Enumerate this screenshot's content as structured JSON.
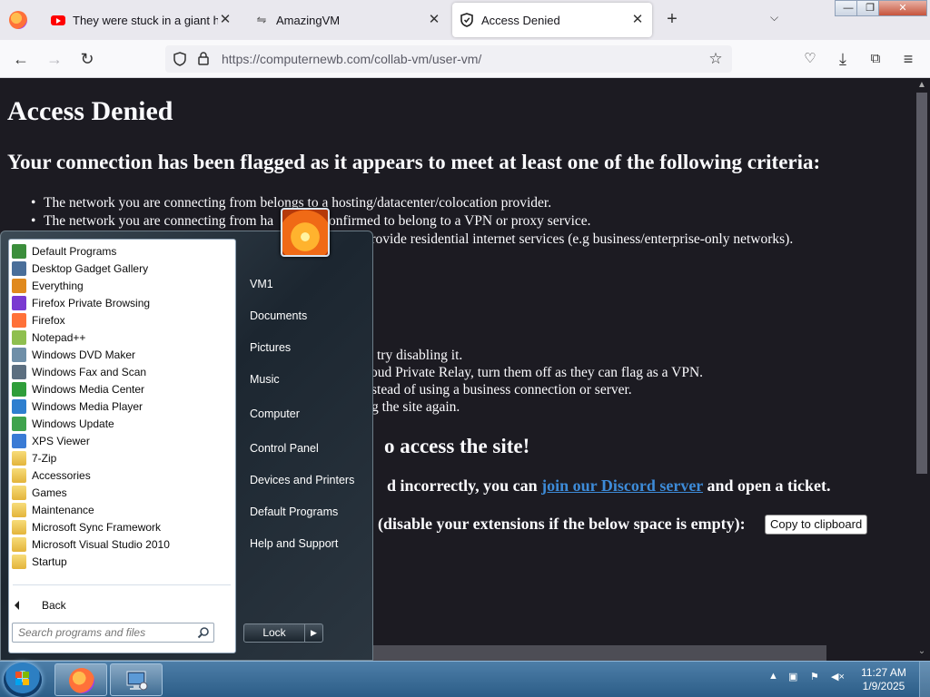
{
  "browser": {
    "tabs": [
      {
        "title": "They were stuck in a giant hole",
        "icon": "youtube-icon",
        "active": false
      },
      {
        "title": "AmazingVM",
        "icon": "vm-icon",
        "active": false
      },
      {
        "title": "Access Denied",
        "icon": "shield-icon",
        "active": true
      }
    ],
    "url": "https://computernewb.com/collab-vm/user-vm/"
  },
  "page": {
    "title": "Access Denied",
    "subtitle": "Your connection has been flagged as it appears to meet at least one of the following criteria:",
    "criteria": [
      "The network you are connecting from belongs to a hosting/datacenter/colocation provider.",
      "The network you are connecting from ha",
      "s not provide residential internet services (e.g business/enterprise-only networks)."
    ],
    "criteria2_tail": "onfirmed to belong to a VPN or proxy service.",
    "fixes": [
      "try disabling it.",
      "oud Private Relay, turn them off as they can flag as a VPN.",
      "stead of using a business connection or server.",
      "g the site again."
    ],
    "access_heading_tail": "o access the site!",
    "discord_pre": "d incorrectly, you can",
    "discord_link": "join our Discord server",
    "discord_post": "and open a ticket.",
    "extensions_text": "(disable your extensions if the below space is empty):",
    "copy_button": "Copy to clipboard"
  },
  "start_menu": {
    "programs": [
      {
        "label": "Default Programs",
        "icon": "default-programs-icon",
        "color": "#3b8e3b"
      },
      {
        "label": "Desktop Gadget Gallery",
        "icon": "gadget-icon",
        "color": "#4a6f9a"
      },
      {
        "label": "Everything",
        "icon": "magnifier-icon",
        "color": "#e08a1e"
      },
      {
        "label": "Firefox Private Browsing",
        "icon": "firefox-private-icon",
        "color": "#7a3ad1"
      },
      {
        "label": "Firefox",
        "icon": "firefox-icon",
        "color": "#ff7139"
      },
      {
        "label": "Notepad++",
        "icon": "notepad-icon",
        "color": "#8fbf4f"
      },
      {
        "label": "Windows DVD Maker",
        "icon": "dvd-icon",
        "color": "#6f8fa8"
      },
      {
        "label": "Windows Fax and Scan",
        "icon": "fax-icon",
        "color": "#5c6f80"
      },
      {
        "label": "Windows Media Center",
        "icon": "media-center-icon",
        "color": "#2f9e3a"
      },
      {
        "label": "Windows Media Player",
        "icon": "media-player-icon",
        "color": "#2e7fcf"
      },
      {
        "label": "Windows Update",
        "icon": "update-icon",
        "color": "#3fa34d"
      },
      {
        "label": "XPS Viewer",
        "icon": "xps-icon",
        "color": "#3a7bd5"
      },
      {
        "label": "7-Zip",
        "icon": "folder-icon",
        "color": "#e3b43b"
      },
      {
        "label": "Accessories",
        "icon": "folder-icon",
        "color": "#e3b43b"
      },
      {
        "label": "Games",
        "icon": "folder-icon",
        "color": "#e3b43b"
      },
      {
        "label": "Maintenance",
        "icon": "folder-icon",
        "color": "#e3b43b"
      },
      {
        "label": "Microsoft Sync Framework",
        "icon": "folder-icon",
        "color": "#e3b43b"
      },
      {
        "label": "Microsoft Visual Studio 2010",
        "icon": "folder-icon",
        "color": "#e3b43b"
      },
      {
        "label": "Startup",
        "icon": "folder-icon",
        "color": "#e3b43b"
      }
    ],
    "back_label": "Back",
    "search_placeholder": "Search programs and files",
    "right_items": [
      "VM1",
      "Documents",
      "Pictures",
      "Music",
      "Computer",
      "Control Panel",
      "Devices and Printers",
      "Default Programs",
      "Help and Support"
    ],
    "lock_label": "Lock"
  },
  "taskbar": {
    "time": "11:27 AM",
    "date": "1/9/2025"
  },
  "colors": {
    "page_bg": "#1c1b22",
    "link": "#3d8bd8",
    "taskbar": "#3a6c98"
  }
}
